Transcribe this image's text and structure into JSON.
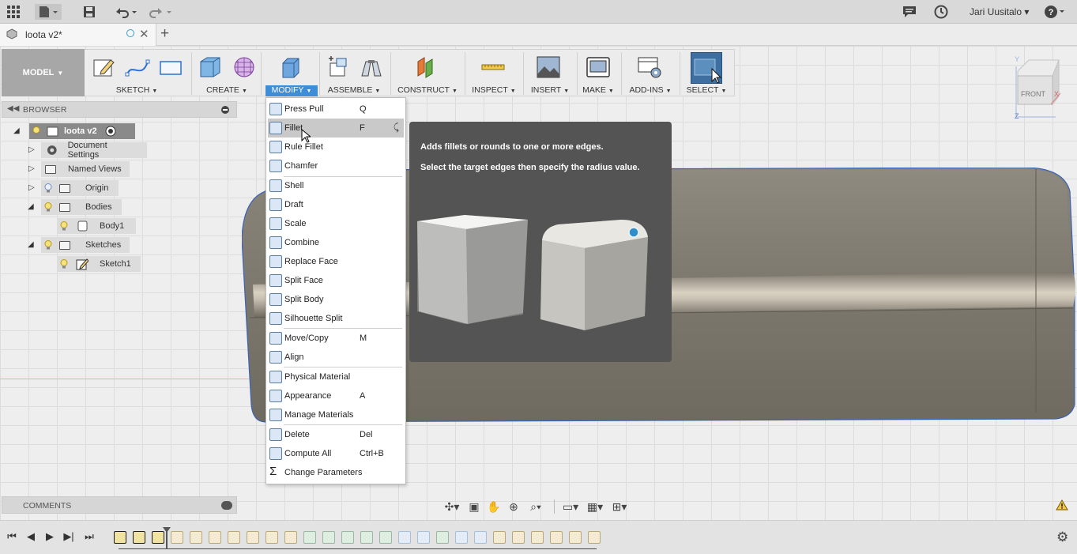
{
  "app": {
    "user_name": "Jari Uusitalo"
  },
  "document": {
    "tab_title": "loota v2*"
  },
  "toolbar": {
    "workspace": "MODEL",
    "groups": [
      {
        "label": "SKETCH"
      },
      {
        "label": "CREATE"
      },
      {
        "label": "MODIFY",
        "active": true
      },
      {
        "label": "ASSEMBLE"
      },
      {
        "label": "CONSTRUCT"
      },
      {
        "label": "INSPECT"
      },
      {
        "label": "INSERT"
      },
      {
        "label": "MAKE"
      },
      {
        "label": "ADD-INS"
      },
      {
        "label": "SELECT"
      }
    ]
  },
  "browser": {
    "title": "BROWSER",
    "root": "loota v2",
    "nodes": [
      {
        "label": "Document Settings"
      },
      {
        "label": "Named Views"
      },
      {
        "label": "Origin"
      },
      {
        "label": "Bodies"
      },
      {
        "label": "Body1"
      },
      {
        "label": "Sketches"
      },
      {
        "label": "Sketch1"
      }
    ]
  },
  "comments": {
    "title": "COMMENTS"
  },
  "modify_menu": {
    "items": [
      {
        "label": "Press Pull",
        "key": "Q",
        "icon": "press-pull-icon"
      },
      {
        "label": "Fillet",
        "key": "F",
        "icon": "fillet-icon",
        "highlighted": true
      },
      {
        "label": "Rule Fillet",
        "key": "",
        "icon": "rule-fillet-icon"
      },
      {
        "label": "Chamfer",
        "key": "",
        "icon": "chamfer-icon"
      },
      {
        "label": "Shell",
        "key": "",
        "icon": "shell-icon"
      },
      {
        "label": "Draft",
        "key": "",
        "icon": "draft-icon"
      },
      {
        "label": "Scale",
        "key": "",
        "icon": "scale-icon"
      },
      {
        "label": "Combine",
        "key": "",
        "icon": "combine-icon"
      },
      {
        "label": "Replace Face",
        "key": "",
        "icon": "replace-face-icon"
      },
      {
        "label": "Split Face",
        "key": "",
        "icon": "split-face-icon"
      },
      {
        "label": "Split Body",
        "key": "",
        "icon": "split-body-icon"
      },
      {
        "label": "Silhouette Split",
        "key": "",
        "icon": "silhouette-split-icon"
      },
      {
        "label": "Move/Copy",
        "key": "M",
        "icon": "move-copy-icon"
      },
      {
        "label": "Align",
        "key": "",
        "icon": "align-icon"
      },
      {
        "label": "Physical Material",
        "key": "",
        "icon": "physical-material-icon"
      },
      {
        "label": "Appearance",
        "key": "A",
        "icon": "appearance-icon"
      },
      {
        "label": "Manage Materials",
        "key": "",
        "icon": "manage-materials-icon"
      },
      {
        "label": "Delete",
        "key": "Del",
        "icon": "delete-icon"
      },
      {
        "label": "Compute All",
        "key": "Ctrl+B",
        "icon": "compute-all-icon"
      },
      {
        "label": "Change Parameters",
        "key": "",
        "icon": "change-parameters-icon"
      }
    ]
  },
  "tooltip": {
    "line1": "Adds fillets or rounds to one or more edges.",
    "line2": "Select the target edges then specify the radius value."
  },
  "viewcube": {
    "face": "FRONT",
    "axis_x": "X",
    "axis_y": "Y",
    "axis_z": "Z"
  },
  "colors": {
    "accent": "#3d8ed6",
    "tooltip_bg": "#545454",
    "body_fill": "#8d877c"
  }
}
